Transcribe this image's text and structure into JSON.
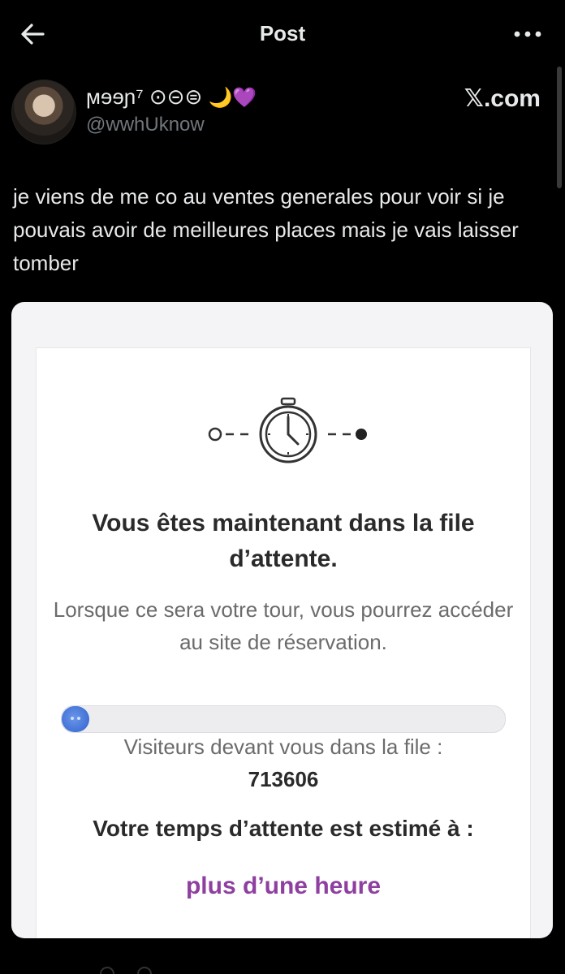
{
  "topbar": {
    "title": "Post",
    "back_icon": "arrow-left-icon",
    "more_icon": "more-dots-icon"
  },
  "author": {
    "display_name": "ϻɘɘɲ⁷ ⊙⊝⊜",
    "display_emojis": "🌙💜",
    "handle": "@wwhUknow"
  },
  "source_label": "𝕏.com",
  "tweet": {
    "text": "je viens de me co au ventes generales pour voir si je pouvais avoir de meilleures places mais je vais laisser tomber"
  },
  "queue": {
    "illustration_icon": "stopwatch-icon",
    "title": "Vous êtes maintenant dans la file d’attente.",
    "subtitle": "Lorsque ce sera votre tour, vous pourrez accéder au site de réservation.",
    "progress_fraction": 0.01,
    "visitors_label": "Visiteurs devant vous dans la file :",
    "visitors_count": "713606",
    "wait_label": "Votre temps d’attente est estimé à :",
    "wait_value": "plus d’une heure",
    "accent_color": "#8e3fa0",
    "progress_color": "#2f62cf"
  }
}
